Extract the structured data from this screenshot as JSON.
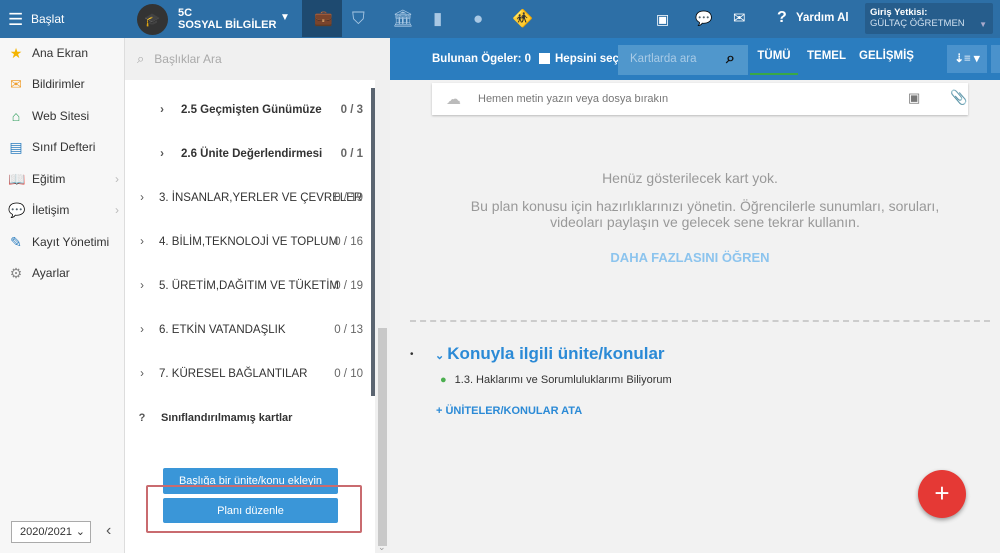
{
  "topbar": {
    "start": "Başlat",
    "class_code": "5C",
    "course": "SOSYAL BİLGİLER",
    "help": "Yardım Al",
    "role_label": "Giriş Yetkisi:",
    "user": "GÜLTAÇ ÖĞRETMEN"
  },
  "sidebar": {
    "items": [
      {
        "label": "Ana Ekran",
        "icon": "star-icon"
      },
      {
        "label": "Bildirimler",
        "icon": "mail-icon"
      },
      {
        "label": "Web Sitesi",
        "icon": "home-icon"
      },
      {
        "label": "Sınıf Defteri",
        "icon": "notebook-icon"
      },
      {
        "label": "Eğitim",
        "icon": "book-icon"
      },
      {
        "label": "İletişim",
        "icon": "chat-icon"
      },
      {
        "label": "Kayıt Yönetimi",
        "icon": "pen-icon"
      },
      {
        "label": "Ayarlar",
        "icon": "gear-icon"
      }
    ],
    "year": "2020/2021"
  },
  "topics": {
    "search_placeholder": "Başlıklar Ara",
    "rows": [
      {
        "title": "2.5  Geçmişten Günümüze",
        "count": "0 / 3"
      },
      {
        "title": "2.6  Ünite Değerlendirmesi",
        "count": "0 / 1"
      },
      {
        "title": "3. İNSANLAR,YERLER VE ÇEVRELER",
        "count": "0 / 19"
      },
      {
        "title": "4. BİLİM,TEKNOLOJİ VE TOPLUM",
        "count": "0 / 16"
      },
      {
        "title": "5. ÜRETİM,DAĞITIM VE TÜKETİM",
        "count": "0 / 19"
      },
      {
        "title": "6. ETKİN VATANDAŞLIK",
        "count": "0 / 13"
      },
      {
        "title": "7. KÜRESEL BAĞLANTILAR",
        "count": "0 / 10"
      }
    ],
    "unclassified": "Sınıflandırılmamış kartlar",
    "add_button": "Başlığa bir ünite/konu ekleyin",
    "edit_button": "Planı düzenle"
  },
  "toolbar": {
    "found": "Bulunan Ögeler: 0",
    "select_all": "Hepsini seç",
    "search_placeholder": "Kartlarda ara",
    "tabs": [
      "TÜMÜ",
      "TEMEL",
      "GELİŞMİŞ"
    ]
  },
  "main": {
    "composer_placeholder": "Hemen metin yazın veya dosya bırakın",
    "empty_title": "Henüz gösterilecek kart yok.",
    "empty_desc": "Bu plan konusu için hazırlıklarınızı yönetin. Öğrencilerle sunumları, soruları, videoları paylaşın ve gelecek sene tekrar kullanın.",
    "learn_more": "DAHA FAZLASINI ÖĞREN",
    "related_title": "Konuyla ilgili ünite/konular",
    "related_item": "1.3. Haklarımı ve Sorumluluklarımı Biliyorum",
    "assign": "ÜNİTELER/KONULAR ATA",
    "fab": "+"
  }
}
